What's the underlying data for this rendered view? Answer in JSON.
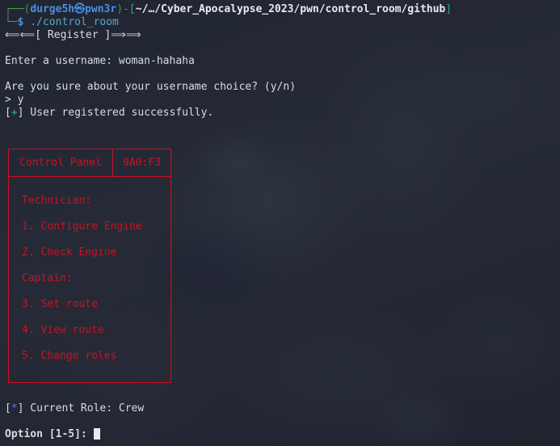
{
  "terminal": {
    "bg_color": "#232834",
    "fg_color": "#d3d7de",
    "accent_red": "#c81323",
    "prompt": {
      "corner_top": "┌──",
      "corner_bottom": "└─",
      "open_paren": "(",
      "user": "durge5h",
      "separator_icon": "kali-at-icon",
      "separator_glyph": "㉿",
      "host": "pwn3r",
      "close_paren": ")",
      "dash": "-",
      "path_open": "[",
      "path": "~/…/Cyber_Apocalypse_2023/pwn/control_room/github",
      "path_close": "]",
      "dollar": "$",
      "command": "./control_room"
    },
    "banner": "⟸⟸[ Register ]⟹⟹",
    "output": [
      "Enter a username: woman-hahaha",
      "",
      "Are you sure about your username choice? (y/n)",
      "> y"
    ],
    "success": {
      "bracket_open": "[",
      "symbol": "+",
      "bracket_close": "]",
      "text": " User registered successfully."
    }
  },
  "panel": {
    "title": "Control Panel",
    "id": "9A0:F3",
    "groups": [
      {
        "role_label": "Technician:",
        "options": [
          "1. Configure Engine",
          "2. Check Engine"
        ]
      },
      {
        "role_label": "Captain:",
        "options": [
          "3. Set route",
          "4. View route",
          "5. Change roles"
        ]
      }
    ]
  },
  "footer": {
    "role_status": {
      "bracket_open": "[",
      "symbol": "*",
      "bracket_close": "]",
      "text": " Current Role: Crew"
    },
    "prompt_label": "Option [1-5]: "
  }
}
